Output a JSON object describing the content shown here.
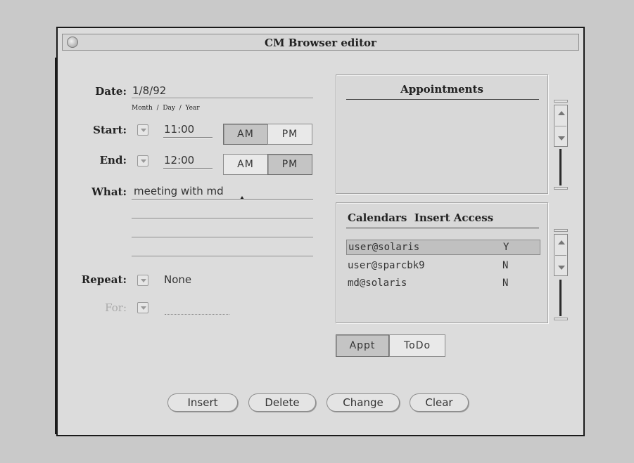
{
  "window": {
    "title": "CM Browser editor"
  },
  "form": {
    "date_label": "Date:",
    "date_value": "1/8/92",
    "date_hint": "Month  /  Day  /  Year",
    "start_label": "Start:",
    "start_time": "11:00",
    "end_label": "End:",
    "end_time": "12:00",
    "am_label": "AM",
    "pm_label": "PM",
    "start_selected": "AM",
    "end_selected": "PM",
    "what_label": "What:",
    "what_lines": [
      "meeting with md",
      "",
      "",
      ""
    ],
    "repeat_label": "Repeat:",
    "repeat_value": "None",
    "for_label": "For:",
    "for_value": ""
  },
  "appointments": {
    "title": "Appointments",
    "items": []
  },
  "calendars": {
    "title": "Calendars  Insert Access",
    "rows": [
      {
        "name": "user@solaris",
        "access": "Y",
        "selected": true
      },
      {
        "name": "user@sparcbk9",
        "access": "N",
        "selected": false
      },
      {
        "name": "md@solaris",
        "access": "N",
        "selected": false
      }
    ]
  },
  "mode": {
    "appt_label": "Appt",
    "todo_label": "ToDo",
    "selected": "Appt"
  },
  "actions": {
    "insert": "Insert",
    "delete": "Delete",
    "change": "Change",
    "clear": "Clear"
  },
  "icons": {
    "window_menu": "window-menu-icon",
    "dropdown": "menu-triangle-icon",
    "scroll_up": "scroll-up-arrow-icon",
    "scroll_down": "scroll-down-arrow-icon"
  }
}
